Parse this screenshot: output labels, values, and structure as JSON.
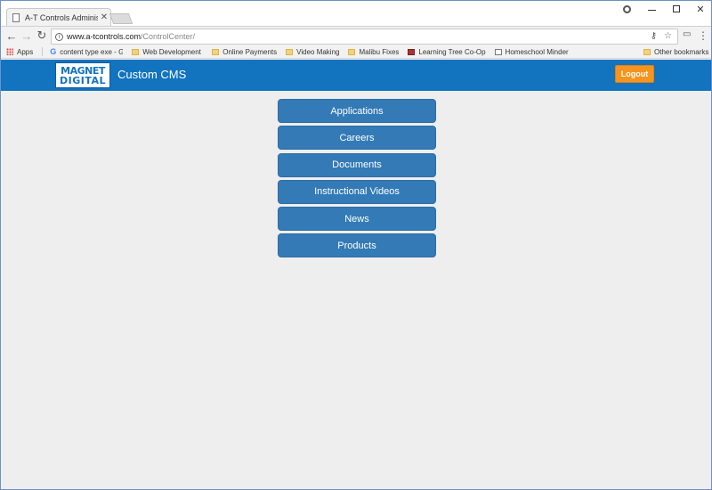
{
  "browser": {
    "tab_title": "A-T Controls Administrat",
    "tab_close": "✕",
    "url_host": "www.a-tcontrols.com",
    "url_path": "/ControlCenter/",
    "bookmarks": [
      {
        "label": "Apps",
        "icon": "apps-grid-icon"
      },
      {
        "label": "content type exe - G",
        "icon": "google-icon"
      },
      {
        "label": "Web Development To",
        "icon": "folder-icon"
      },
      {
        "label": "Online Payments",
        "icon": "folder-icon"
      },
      {
        "label": "Video Making",
        "icon": "folder-icon"
      },
      {
        "label": "Malibu Fixes",
        "icon": "folder-icon"
      },
      {
        "label": "Learning Tree Co-Op",
        "icon": "site-icon"
      },
      {
        "label": "Homeschool Minder",
        "icon": "page-icon"
      }
    ],
    "other_bookmarks": "Other bookmarks"
  },
  "header": {
    "logo_line1": "MAGNET",
    "logo_line2": "DIGITAL",
    "title": "Custom CMS",
    "logout_label": "Logout",
    "colors": {
      "bar": "#1273bf",
      "logout": "#f7941d"
    }
  },
  "menu": {
    "items": [
      {
        "label": "Applications"
      },
      {
        "label": "Careers"
      },
      {
        "label": "Documents"
      },
      {
        "label": "Instructional Videos"
      },
      {
        "label": "News"
      },
      {
        "label": "Products"
      }
    ],
    "button_color": "#337ab7"
  }
}
